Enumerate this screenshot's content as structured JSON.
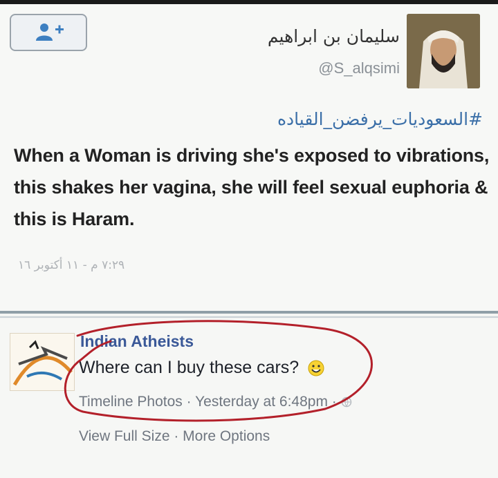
{
  "tweet": {
    "display_name": "سليمان بن ابراهيم",
    "handle": "@S_alqsimi",
    "hashtag": "#السعوديات_يرفضن_القياده",
    "text": "When a Woman  is driving she's exposed to vibrations, this shakes her vagina, she will feel sexual euphoria & this is Haram.",
    "timestamp": "٧:٢٩ م - ١١ أكتوبر ١٦",
    "follow_icon": "add-user-icon"
  },
  "facebook": {
    "page_name": "Indian Atheists",
    "comment": "Where can I buy these cars?",
    "meta": {
      "album": "Timeline Photos",
      "sep1": " · ",
      "time": "Yesterday at 6:48pm",
      "sep2": " · "
    },
    "actions": {
      "view_full": "View Full Size",
      "sep": " · ",
      "more": "More Options"
    }
  },
  "colors": {
    "link_blue": "#3b5998",
    "hashtag_blue": "#3b6fa8",
    "annotation_red": "#b3202a"
  }
}
